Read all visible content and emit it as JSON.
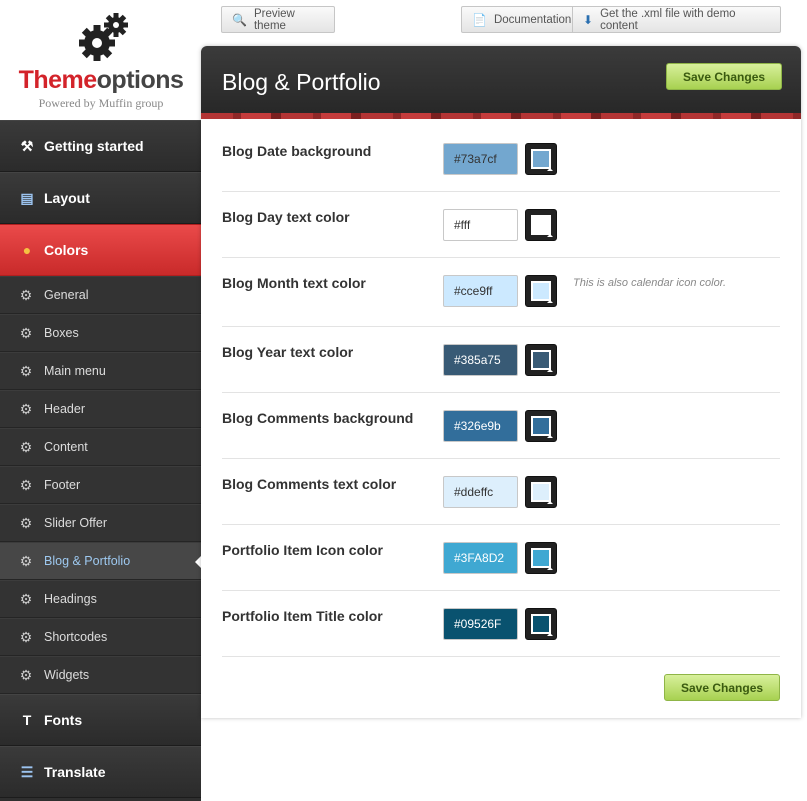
{
  "logo": {
    "title_a": "Theme",
    "title_b": "options",
    "subtitle": "Powered by Muffin group"
  },
  "top": {
    "preview": "Preview theme",
    "docs": "Documentation",
    "xml": "Get the .xml file with demo content"
  },
  "sidebar": {
    "main": [
      {
        "label": "Getting started",
        "icon": "tools-icon"
      },
      {
        "label": "Layout",
        "icon": "layout-icon"
      },
      {
        "label": "Colors",
        "icon": "palette-icon"
      }
    ],
    "sub": [
      "General",
      "Boxes",
      "Main menu",
      "Header",
      "Content",
      "Footer",
      "Slider Offer",
      "Blog & Portfolio",
      "Headings",
      "Shortcodes",
      "Widgets"
    ],
    "bottom": [
      {
        "label": "Fonts",
        "icon": "font-icon"
      },
      {
        "label": "Translate",
        "icon": "translate-icon"
      }
    ]
  },
  "panel": {
    "title": "Blog & Portfolio",
    "save": "Save Changes"
  },
  "options": [
    {
      "label": "Blog Date background",
      "value": "#73a7cf",
      "swatch": "#73a7cf",
      "text": "#333"
    },
    {
      "label": "Blog Day text color",
      "value": "#fff",
      "swatch": "#ffffff",
      "text": "#333"
    },
    {
      "label": "Blog Month text color",
      "value": "#cce9ff",
      "swatch": "#cce9ff",
      "text": "#333",
      "note": "This is also calendar icon color."
    },
    {
      "label": "Blog Year text color",
      "value": "#385a75",
      "swatch": "#385a75",
      "text": "#fff"
    },
    {
      "label": "Blog Comments background",
      "value": "#326e9b",
      "swatch": "#326e9b",
      "text": "#fff"
    },
    {
      "label": "Blog Comments text color",
      "value": "#ddeffc",
      "swatch": "#ddeffc",
      "text": "#333"
    },
    {
      "label": "Portfolio Item Icon color",
      "value": "#3FA8D2",
      "swatch": "#3FA8D2",
      "text": "#fff"
    },
    {
      "label": "Portfolio Item Title color",
      "value": "#09526F",
      "swatch": "#09526F",
      "text": "#fff"
    }
  ]
}
